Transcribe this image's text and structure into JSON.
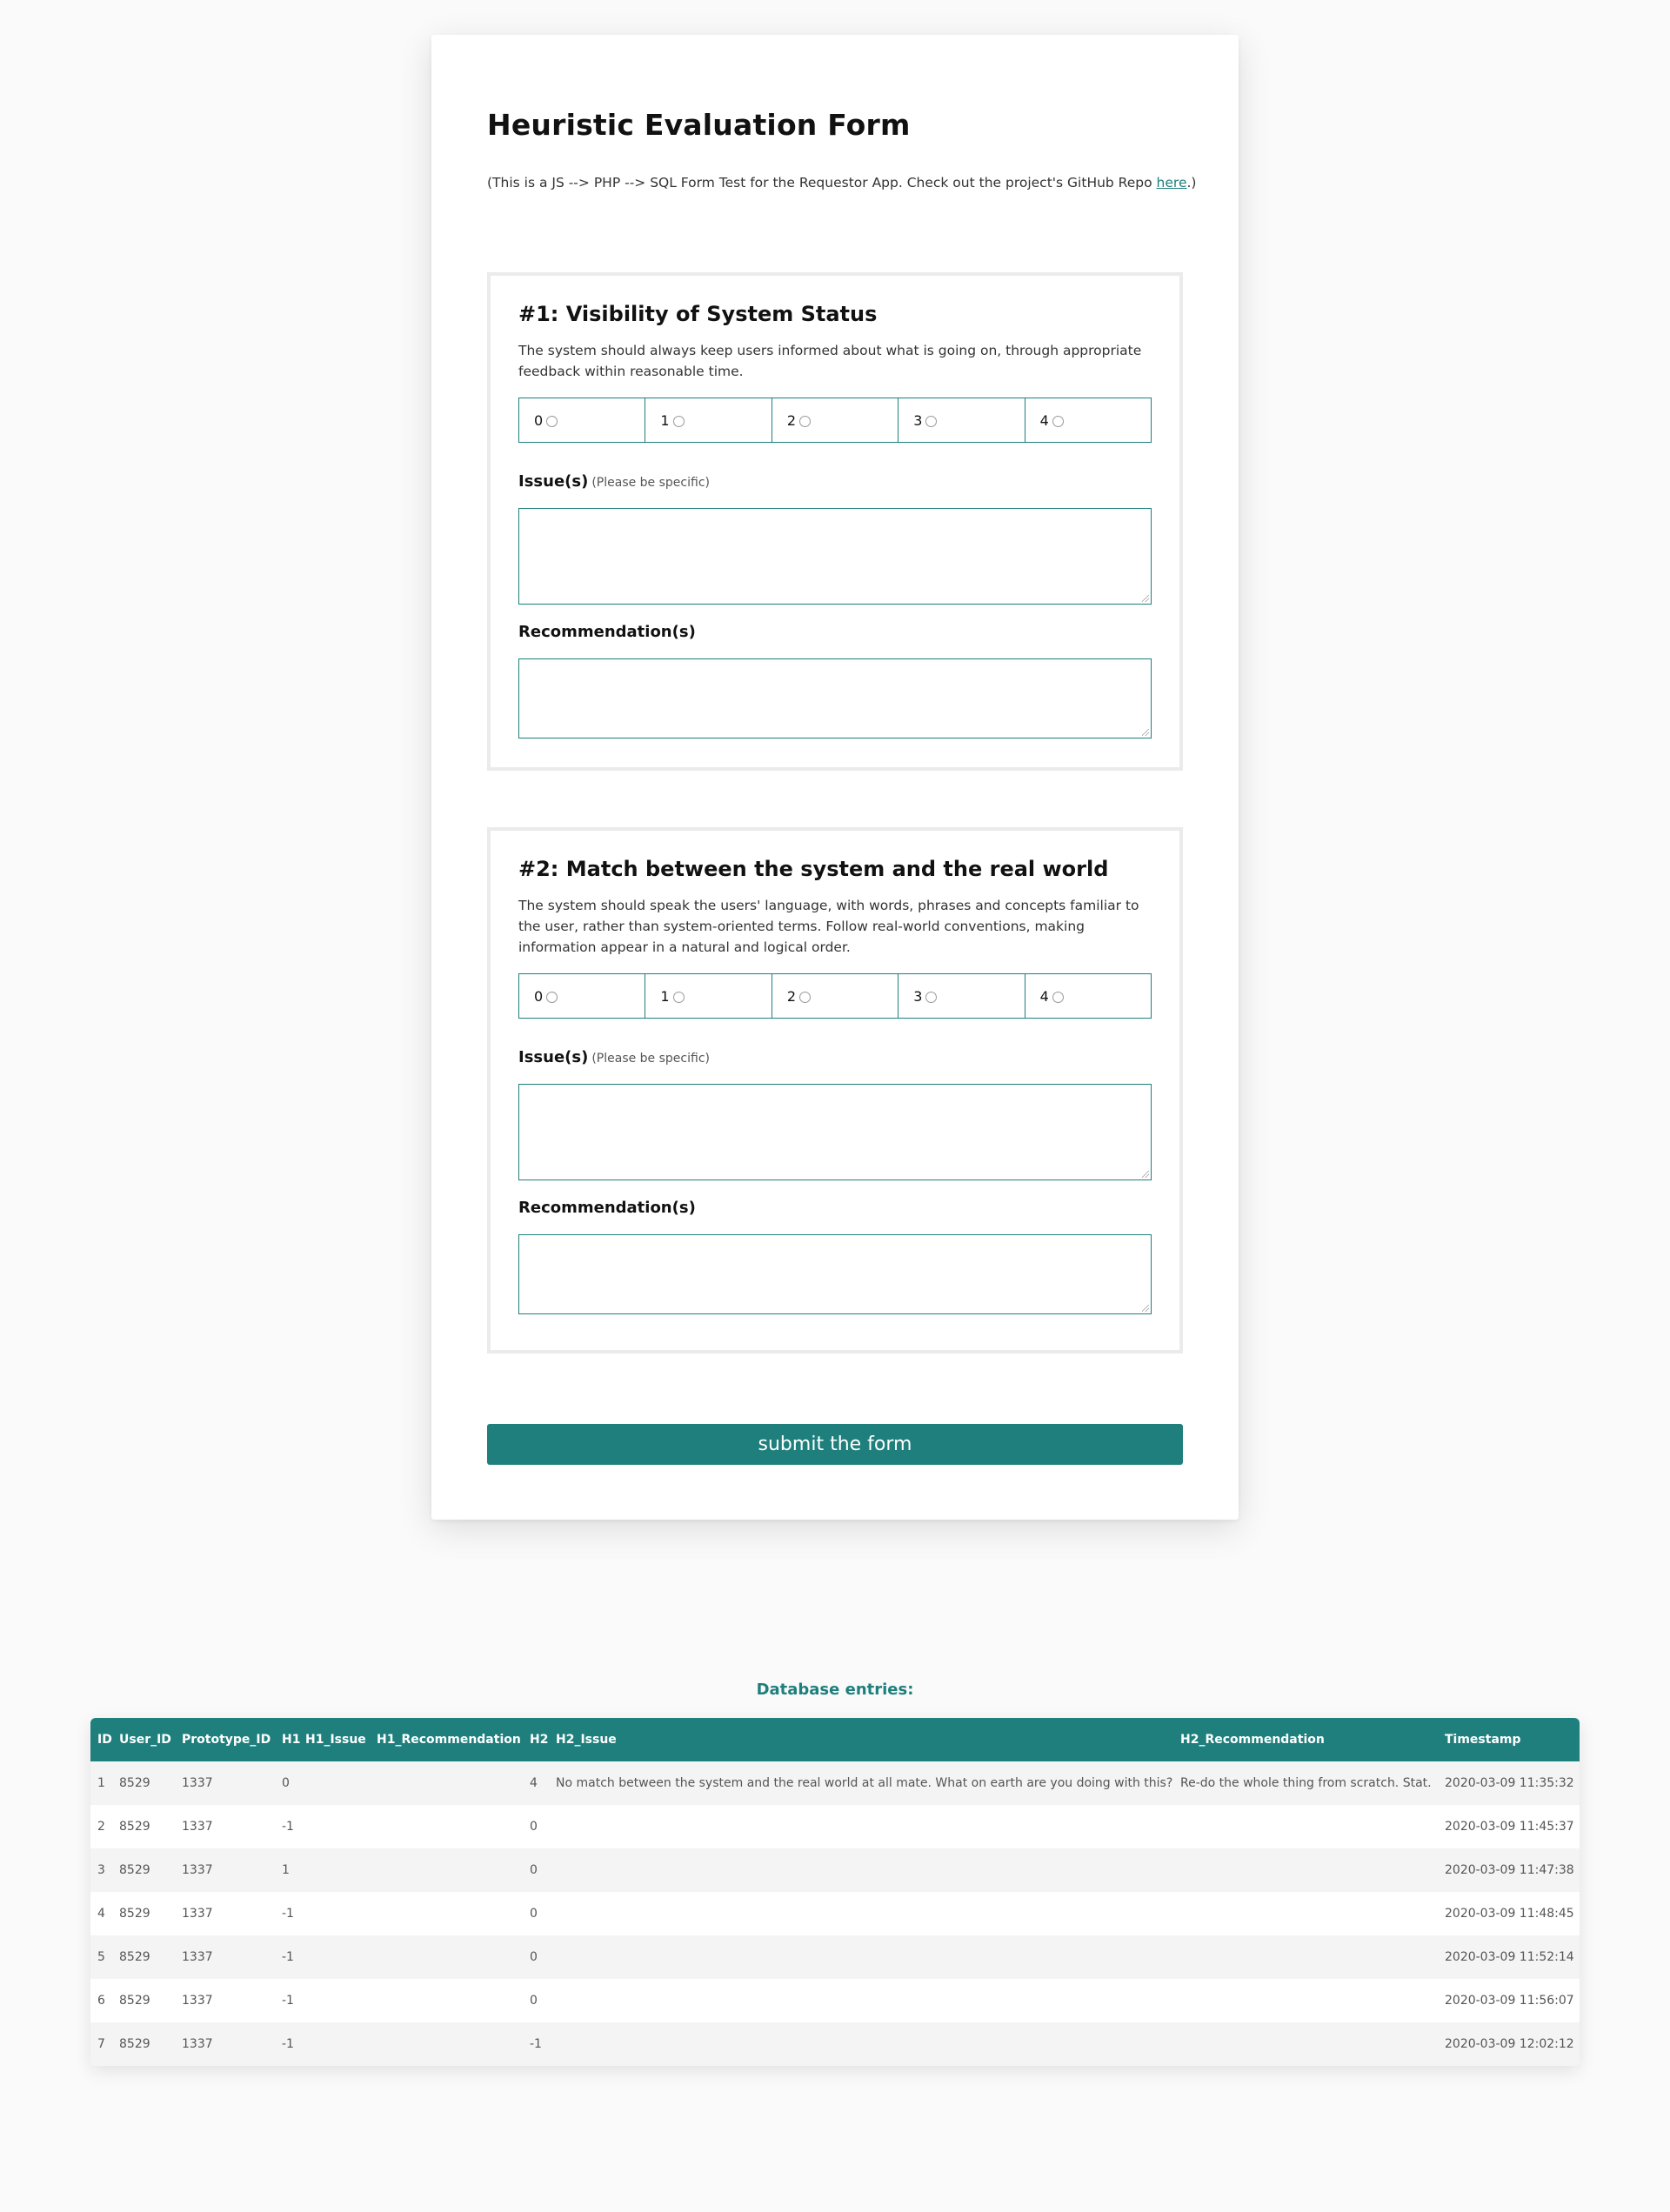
{
  "form": {
    "title": "Heuristic Evaluation Form",
    "intro_prefix": "(This is a JS --> PHP --> SQL Form Test for the Requestor App. Check out the project's GitHub Repo ",
    "intro_link": "here",
    "intro_suffix": ".)",
    "sections": [
      {
        "heading": "#1: Visibility of System Status",
        "description": "The system should always keep users informed about what is going on, through appropriate feedback within reasonable time.",
        "ratings": [
          "0",
          "1",
          "2",
          "3",
          "4"
        ],
        "issue_label": "Issue(s)",
        "issue_hint": "(Please be specific)",
        "recommendation_label": "Recommendation(s)"
      },
      {
        "heading": "#2: Match between the system and the real world",
        "description": "The system should speak the users' language, with words, phrases and concepts familiar to the user, rather than system-oriented terms. Follow real-world conventions, making information appear in a natural and logical order.",
        "ratings": [
          "0",
          "1",
          "2",
          "3",
          "4"
        ],
        "issue_label": "Issue(s)",
        "issue_hint": "(Please be specific)",
        "recommendation_label": "Recommendation(s)"
      }
    ],
    "submit_label": "submit the form"
  },
  "database": {
    "title": "Database entries:",
    "columns": [
      "ID",
      "User_ID",
      "Prototype_ID",
      "H1",
      "H1_Issue",
      "H1_Recommendation",
      "H2",
      "H2_Issue",
      "H2_Recommendation",
      "Timestamp"
    ],
    "rows": [
      [
        "1",
        "8529",
        "1337",
        "0",
        "",
        "",
        "4",
        "No match between the system and the real world at all mate. What on earth are you doing with this?",
        "Re-do the whole thing from scratch. Stat.",
        "2020-03-09 11:35:32"
      ],
      [
        "2",
        "8529",
        "1337",
        "-1",
        "",
        "",
        "0",
        "",
        "",
        "2020-03-09 11:45:37"
      ],
      [
        "3",
        "8529",
        "1337",
        "1",
        "",
        "",
        "0",
        "",
        "",
        "2020-03-09 11:47:38"
      ],
      [
        "4",
        "8529",
        "1337",
        "-1",
        "",
        "",
        "0",
        "",
        "",
        "2020-03-09 11:48:45"
      ],
      [
        "5",
        "8529",
        "1337",
        "-1",
        "",
        "",
        "0",
        "",
        "",
        "2020-03-09 11:52:14"
      ],
      [
        "6",
        "8529",
        "1337",
        "-1",
        "",
        "",
        "0",
        "",
        "",
        "2020-03-09 11:56:07"
      ],
      [
        "7",
        "8529",
        "1337",
        "-1",
        "",
        "",
        "-1",
        "",
        "",
        "2020-03-09 12:02:12"
      ]
    ]
  }
}
